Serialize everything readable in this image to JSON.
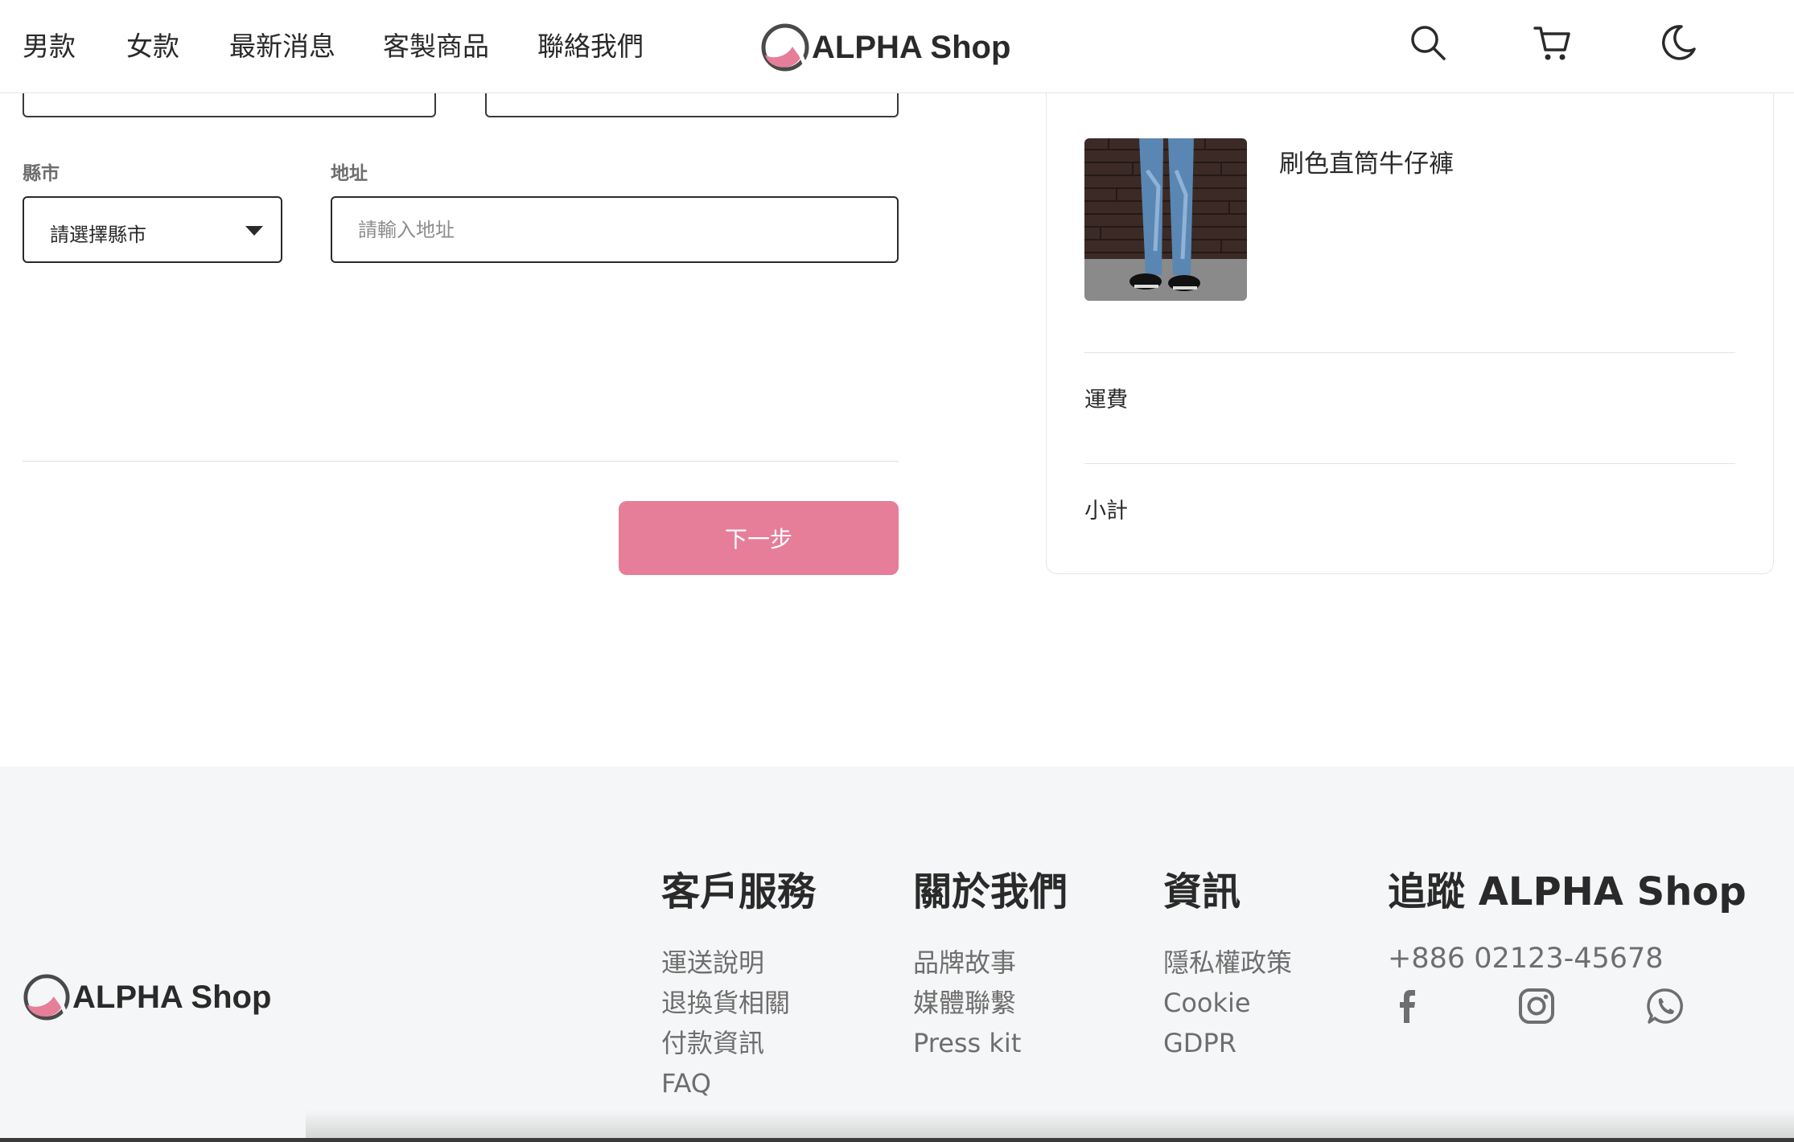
{
  "header": {
    "nav": [
      "男款",
      "女款",
      "最新消息",
      "客製商品",
      "聯絡我們"
    ],
    "logo_text": "ALPHA Shop",
    "icons": [
      "search-icon",
      "cart-icon",
      "moon-icon"
    ]
  },
  "form": {
    "city_label": "縣市",
    "city_selected": "請選擇縣市",
    "address_label": "地址",
    "address_placeholder": "請輸入地址",
    "address_value": "",
    "next_button": "下一步"
  },
  "cart": {
    "item_name": "刷色直筒牛仔褲",
    "shipping_label": "運費",
    "subtotal_label": "小計"
  },
  "footer": {
    "logo_text": "ALPHA Shop",
    "customer_service": {
      "title": "客戶服務",
      "links": [
        "運送說明",
        "退換貨相關",
        "付款資訊",
        "FAQ"
      ]
    },
    "about": {
      "title": "關於我們",
      "links": [
        "品牌故事",
        "媒體聯繫",
        "Press kit"
      ]
    },
    "info": {
      "title": "資訊",
      "links": [
        "隱私權政策",
        "Cookie",
        "GDPR"
      ]
    },
    "follow": {
      "title": "追蹤 ALPHA Shop",
      "phone": "+886 02123-45678",
      "social": [
        "facebook-icon",
        "instagram-icon",
        "whatsapp-icon"
      ]
    }
  },
  "colors": {
    "accent": "#e67e99",
    "text": "#2a2a2a",
    "muted": "#6e6e6e",
    "footer_bg": "#f5f6f7"
  }
}
